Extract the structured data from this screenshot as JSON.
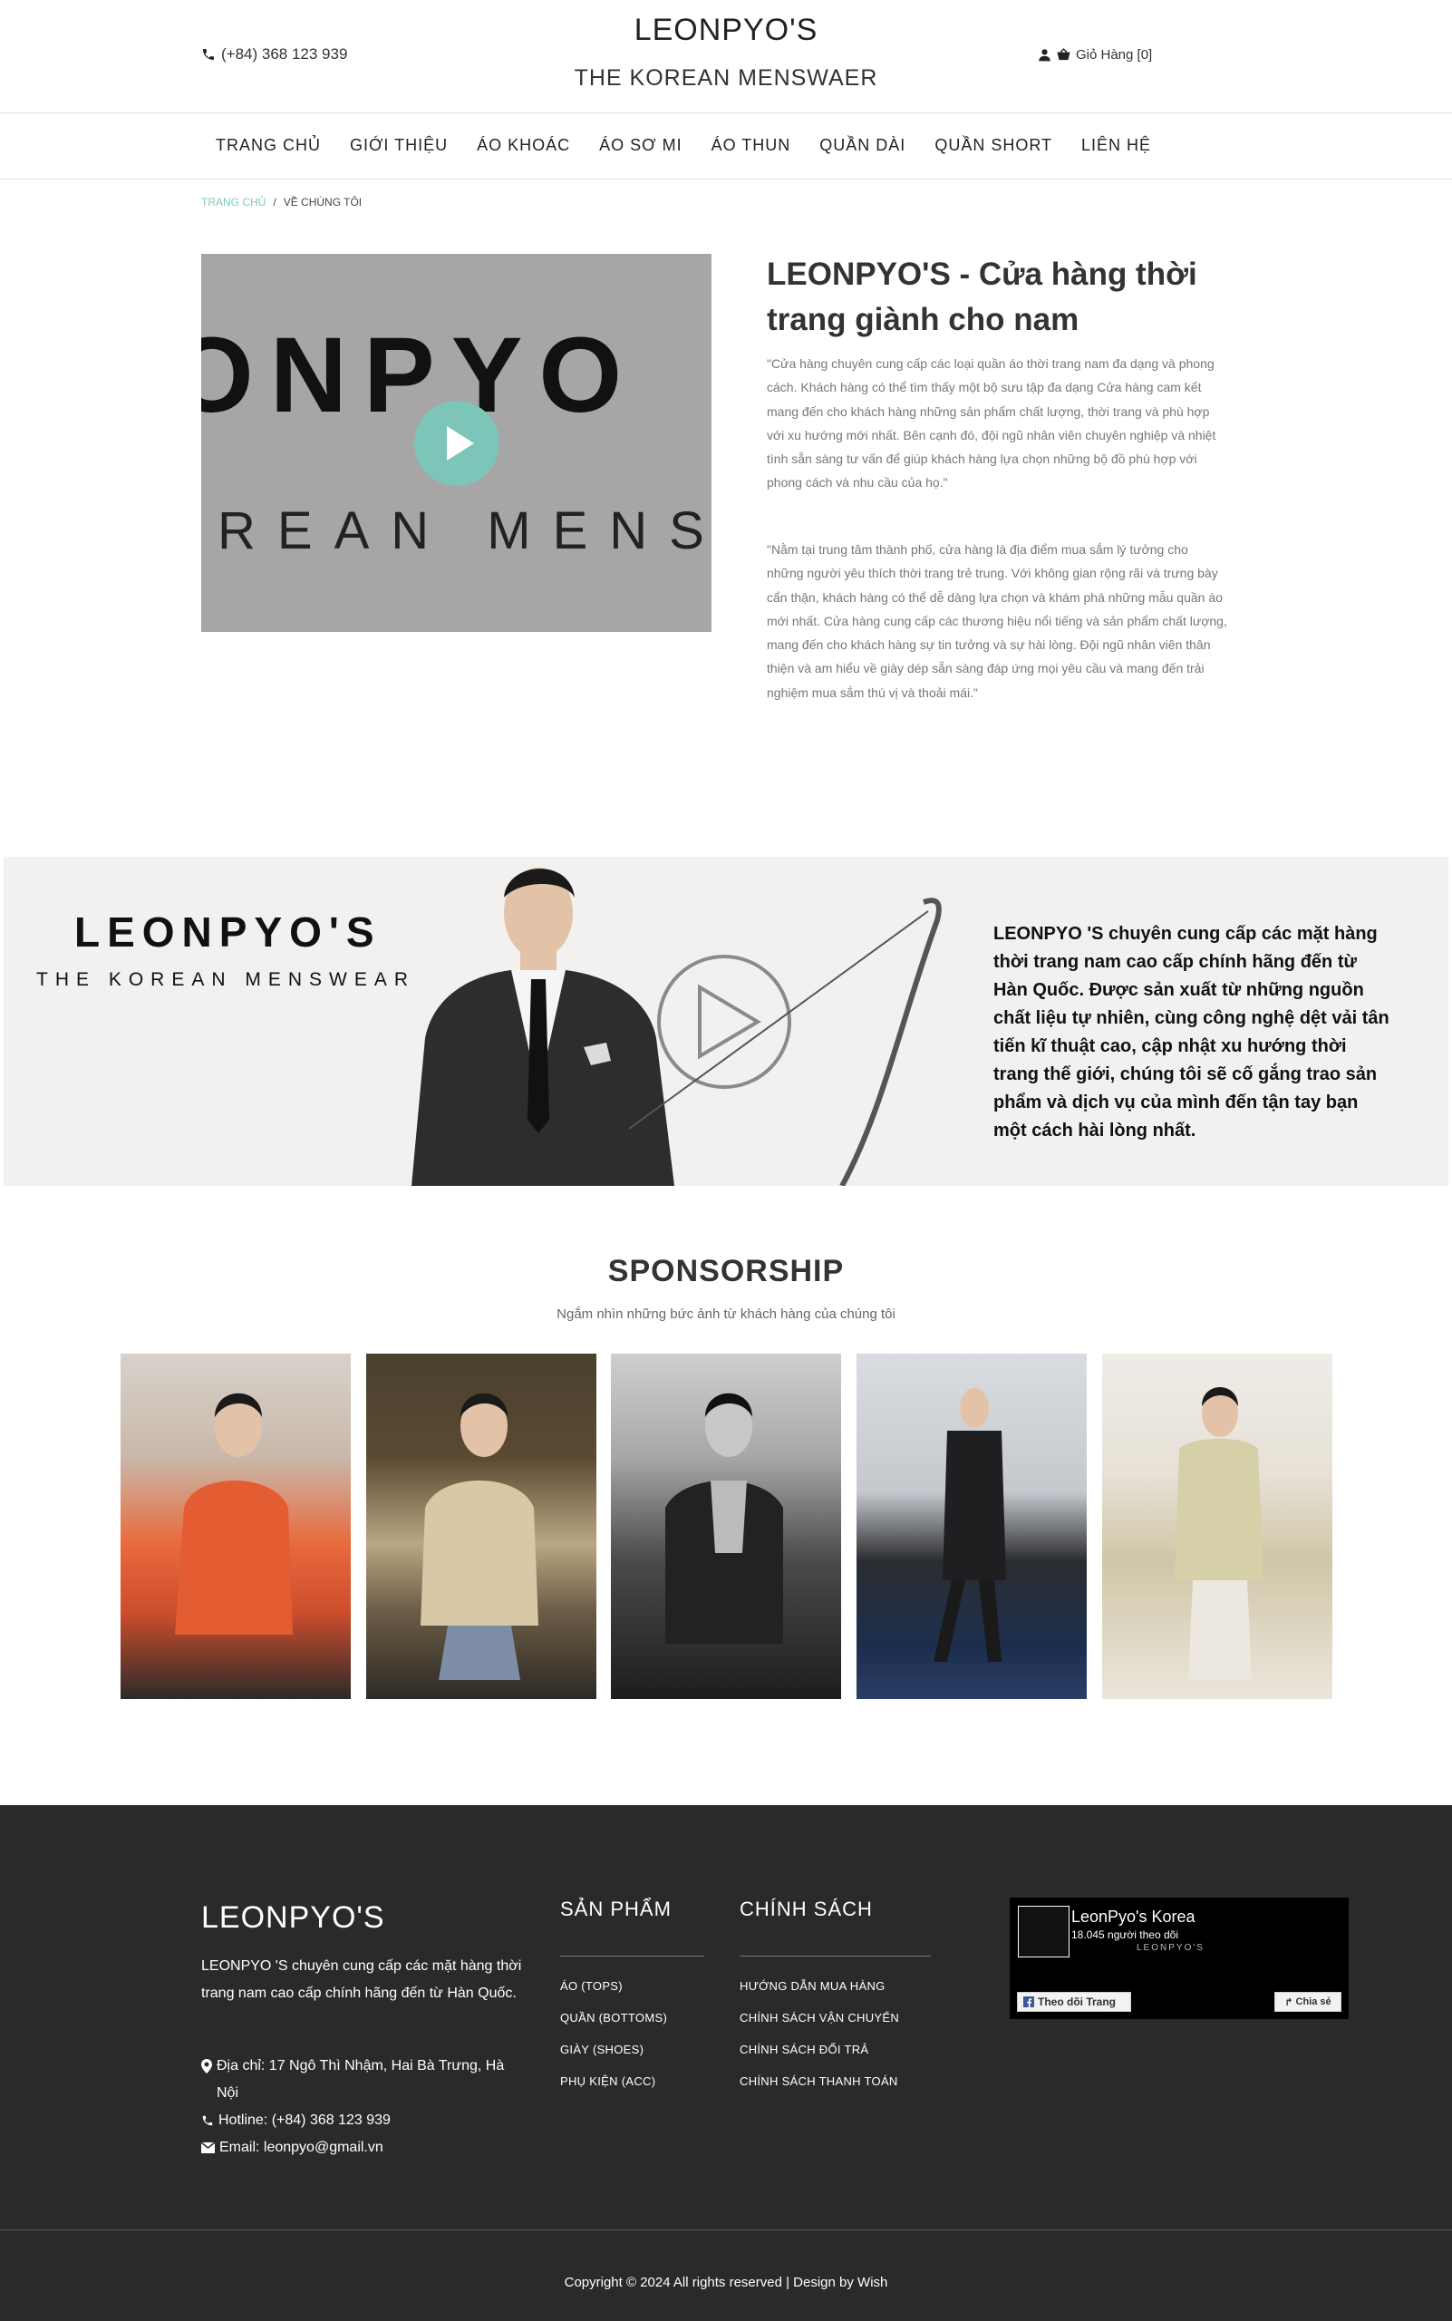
{
  "header": {
    "phone": "(+84) 368 123 939",
    "logo_title": "LEONPYO'S",
    "logo_subtitle": "THE KOREAN MENSWAER",
    "cart_label": "Giỏ Hàng [0]"
  },
  "nav": {
    "items": [
      "TRANG CHỦ",
      "GIỚI THIỆU",
      "ÁO KHOÁC",
      "ÁO SƠ MI",
      "ÁO THUN",
      "QUẦN DÀI",
      "QUẦN SHORT",
      "LIÊN HỆ"
    ]
  },
  "breadcrumb": {
    "home": "TRANG CHỦ",
    "separator": "/",
    "current": "VỀ CHÚNG TÔI"
  },
  "about": {
    "video_text_line1": "ONPYO",
    "video_text_line2": "REAN MENS",
    "title": "LEONPYO'S - Cửa hàng thời trang giành cho nam",
    "paragraph1": "\"Cửa hàng chuyên cung cấp các loại quần áo thời trang nam đa dạng và phong cách. Khách hàng có thể tìm thấy một bộ sưu tập đa dạng Cửa hàng cam kết mang đến cho khách hàng những sản phẩm chất lượng, thời trang và phù hợp với xu hướng mới nhất. Bên cạnh đó, đội ngũ nhân viên chuyên nghiệp và nhiệt tình sẵn sàng tư vấn để giúp khách hàng lựa chọn những bộ đồ phù hợp với phong cách và nhu cầu của họ.\"",
    "paragraph2": "\"Nằm tại trung tâm thành phố, cửa hàng là địa điểm mua sắm lý tưởng cho những người yêu thích thời trang trẻ trung. Với không gian rộng rãi và trưng bày cẩn thận, khách hàng có thể dễ dàng lựa chọn và khám phá những mẫu quần áo mới nhất. Cửa hàng cung cấp các thương hiệu nổi tiếng và sản phẩm chất lượng, mang đến cho khách hàng sự tin tưởng và sự hài lòng. Đội ngũ nhân viên thân thiện và am hiểu về giày dép sẵn sàng đáp ứng mọi yêu cầu và mang đến trải nghiệm mua sắm thú vị và thoải mái.\""
  },
  "banner": {
    "logo": "LEONPYO'S",
    "subtitle": "THE KOREAN MENSWEAR",
    "text": "LEONPYO 'S chuyên cung cấp các mặt hàng thời trang nam cao cấp chính hãng đến từ Hàn Quốc. Được sản xuất từ những nguồn chất liệu tự nhiên, cùng công nghệ dệt vải tân tiến kĩ thuật cao, cập nhật xu hướng thời trang thế giới, chúng tôi sẽ cố gắng trao sản phẩm và dịch vụ của mình đến tận tay bạn một cách hài lòng nhất."
  },
  "sponsorship": {
    "title": "SPONSORSHIP",
    "subtitle": "Ngắm nhìn những bức ảnh từ khách hàng của chúng tôi"
  },
  "footer": {
    "brand": "LEONPYO'S",
    "description": "LEONPYO 'S chuyên cung cấp các mặt hàng thời trang nam cao cấp chính hãng đến từ Hàn Quốc.",
    "address": "Địa chỉ: 17 Ngô Thì Nhậm, Hai Bà Trưng, Hà Nội",
    "hotline": "Hotline: (+84) 368 123 939",
    "email": "Email: leonpyo@gmail.vn",
    "products_title": "SẢN PHẨM",
    "products": [
      "ÁO (TOPS)",
      "QUẦN (BOTTOMS)",
      "GIÀY (SHOES)",
      "PHỤ KIỆN (ACC)"
    ],
    "policy_title": "CHÍNH SÁCH",
    "policies": [
      "HƯỚNG DẪN MUA HÀNG",
      "CHÍNH SÁCH VẬN CHUYỂN",
      "CHÍNH SÁCH ĐỔI TRẢ",
      "CHÍNH SÁCH THANH TOÁN"
    ],
    "fb_page_name": "LeonPyo's Korea",
    "fb_followers": "18.045 người theo dõi",
    "fb_mini_logo": "LEONPYO'S",
    "fb_follow_label": "Theo dõi Trang",
    "fb_share_label": "Chia sẻ",
    "copyright": "Copyright © 2024 All rights reserved | Design by Wish"
  },
  "colors": {
    "accent": "#7ec9bd",
    "footer_bg": "#2a2a2a",
    "text": "#333333"
  }
}
